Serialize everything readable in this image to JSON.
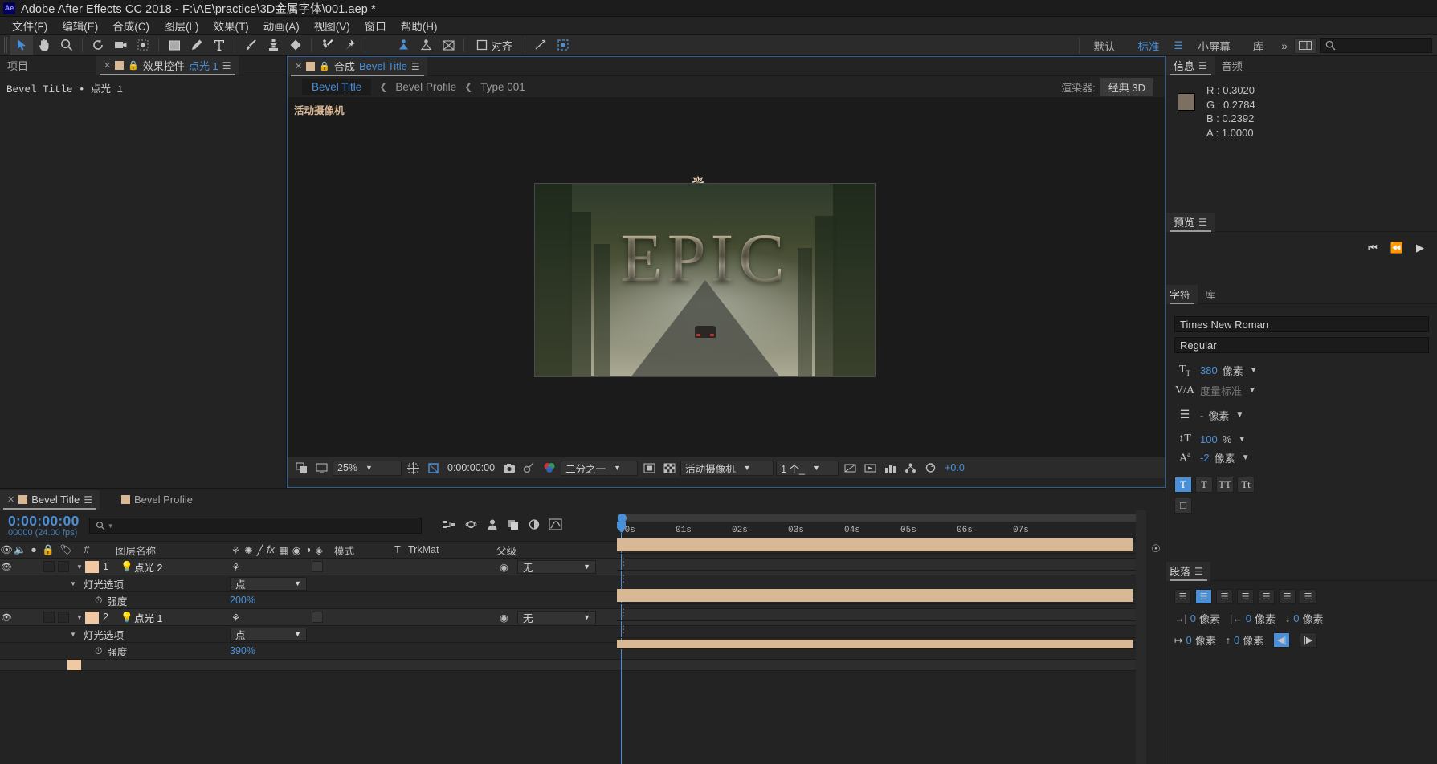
{
  "titlebar": {
    "logo": "Ae",
    "title": "Adobe After Effects CC 2018 - F:\\AE\\practice\\3D金属字体\\001.aep *"
  },
  "menubar": {
    "items": [
      "文件(F)",
      "编辑(E)",
      "合成(C)",
      "图层(L)",
      "效果(T)",
      "动画(A)",
      "视图(V)",
      "窗口",
      "帮助(H)"
    ]
  },
  "toolbar": {
    "align_label": "对齐",
    "workspaces": [
      "默认",
      "标准",
      "小屏幕",
      "库"
    ],
    "selected_workspace": "标准",
    "search_placeholder": ""
  },
  "effects_panel": {
    "tabs": [
      {
        "label": "项目",
        "active": false
      },
      {
        "label": "效果控件",
        "active": true,
        "value": "点光 1"
      }
    ],
    "header": "Bevel Title • 点光 1"
  },
  "comp_panel": {
    "tabs": [
      {
        "label": "合成",
        "value": "Bevel Title"
      }
    ],
    "breadcrumb": [
      {
        "label": "Bevel Title",
        "current": true
      },
      {
        "label": "Bevel Profile",
        "current": false
      },
      {
        "label": "Type 001",
        "current": false
      }
    ],
    "renderer_label": "渲染器:",
    "renderer_value": "经典 3D",
    "camera_label": "活动摄像机",
    "comp_text": "EPIC",
    "bottombar": {
      "zoom": "25%",
      "timecode": "0:00:00:00",
      "resolution": "二分之一",
      "view": "活动摄像机",
      "views_count": "1 个_",
      "exposure": "+0.0"
    }
  },
  "info_panel": {
    "tabs": [
      "信息",
      "音频"
    ],
    "rows": [
      {
        "label": "R :",
        "value": "0.3020"
      },
      {
        "label": "G :",
        "value": "0.2784"
      },
      {
        "label": "B :",
        "value": "0.2392"
      },
      {
        "label": "A :",
        "value": "1.0000"
      }
    ]
  },
  "preview_panel": {
    "tabs": [
      "预览"
    ]
  },
  "character_panel": {
    "tabs": [
      "字符",
      "库"
    ],
    "font_family": "Times New Roman",
    "font_style": "Regular",
    "font_size": {
      "value": "380",
      "unit": "像素"
    },
    "tracking_kerning": "度量标准",
    "leading": {
      "value": "-",
      "unit": "像素"
    },
    "vertical_scale": {
      "value": "100",
      "unit": "%"
    },
    "baseline_shift": {
      "value": "-2",
      "unit": "像素"
    },
    "style_buttons": [
      "T",
      "T",
      "TT",
      "Tt"
    ]
  },
  "paragraph_panel": {
    "tabs": [
      "段落"
    ],
    "indent_rows": [
      {
        "value": "0",
        "unit": "像素"
      },
      {
        "value": "0",
        "unit": "像素"
      },
      {
        "value": "0",
        "unit": "像素"
      },
      {
        "value": "0",
        "unit": "像素"
      },
      {
        "value": "0",
        "unit": "像素"
      }
    ]
  },
  "timeline": {
    "tabs": [
      {
        "label": "Bevel Title",
        "active": true
      },
      {
        "label": "Bevel Profile",
        "active": false
      }
    ],
    "timecode": "0:00:00:00",
    "frames": "00000 (24.00 fps)",
    "search_placeholder": "",
    "columns": [
      "#",
      "图层名称",
      "模式",
      "T",
      "TrkMat",
      "父级"
    ],
    "rows": [
      {
        "type": "layer",
        "index": "1",
        "name": "点光 2",
        "parent": "无"
      },
      {
        "type": "group",
        "name": "灯光选项",
        "value": "点"
      },
      {
        "type": "prop",
        "name": "强度",
        "value": "200",
        "unit": "%"
      },
      {
        "type": "layer",
        "index": "2",
        "name": "点光 1",
        "parent": "无"
      },
      {
        "type": "group",
        "name": "灯光选项",
        "value": "点"
      },
      {
        "type": "prop",
        "name": "强度",
        "value": "390",
        "unit": "%"
      }
    ],
    "ruler_ticks": [
      "00s",
      "01s",
      "02s",
      "03s",
      "04s",
      "05s",
      "06s",
      "07s"
    ]
  },
  "colors": {
    "accent": "#4a90d9",
    "layer_bar": "#d9b995",
    "panel_bg": "#232323"
  }
}
